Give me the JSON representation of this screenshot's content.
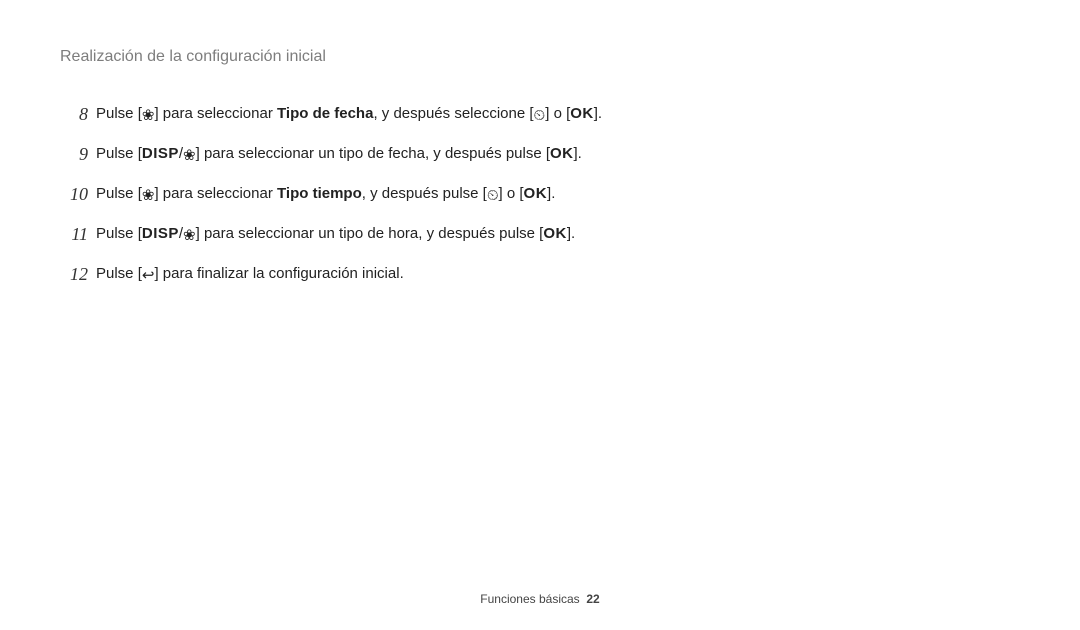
{
  "header": "Realización de la configuración inicial",
  "steps": [
    {
      "num": "8",
      "parts": [
        {
          "t": "text",
          "v": "Pulse ["
        },
        {
          "t": "icon",
          "name": "macro-icon",
          "glyph": "❀"
        },
        {
          "t": "text",
          "v": "] para seleccionar "
        },
        {
          "t": "bold",
          "v": "Tipo de fecha"
        },
        {
          "t": "text",
          "v": ", y después seleccione ["
        },
        {
          "t": "icon",
          "name": "timer-icon",
          "glyph": "⏲"
        },
        {
          "t": "text",
          "v": "] o ["
        },
        {
          "t": "ok",
          "v": "OK"
        },
        {
          "t": "text",
          "v": "]."
        }
      ]
    },
    {
      "num": "9",
      "parts": [
        {
          "t": "text",
          "v": "Pulse ["
        },
        {
          "t": "disp",
          "v": "DISP"
        },
        {
          "t": "text",
          "v": "/"
        },
        {
          "t": "icon",
          "name": "macro-icon",
          "glyph": "❀"
        },
        {
          "t": "text",
          "v": "] para seleccionar un tipo de fecha, y después pulse ["
        },
        {
          "t": "ok",
          "v": "OK"
        },
        {
          "t": "text",
          "v": "]."
        }
      ]
    },
    {
      "num": "10",
      "parts": [
        {
          "t": "text",
          "v": "Pulse ["
        },
        {
          "t": "icon",
          "name": "macro-icon",
          "glyph": "❀"
        },
        {
          "t": "text",
          "v": "] para seleccionar "
        },
        {
          "t": "bold",
          "v": "Tipo tiempo"
        },
        {
          "t": "text",
          "v": ", y después pulse ["
        },
        {
          "t": "icon",
          "name": "timer-icon",
          "glyph": "⏲"
        },
        {
          "t": "text",
          "v": "] o ["
        },
        {
          "t": "ok",
          "v": "OK"
        },
        {
          "t": "text",
          "v": "]."
        }
      ]
    },
    {
      "num": "11",
      "parts": [
        {
          "t": "text",
          "v": "Pulse ["
        },
        {
          "t": "disp",
          "v": "DISP"
        },
        {
          "t": "text",
          "v": "/"
        },
        {
          "t": "icon",
          "name": "macro-icon",
          "glyph": "❀"
        },
        {
          "t": "text",
          "v": "] para seleccionar un tipo de hora, y después pulse ["
        },
        {
          "t": "ok",
          "v": "OK"
        },
        {
          "t": "text",
          "v": "]."
        }
      ]
    },
    {
      "num": "12",
      "parts": [
        {
          "t": "text",
          "v": "Pulse ["
        },
        {
          "t": "icon",
          "name": "back-icon",
          "glyph": "↩"
        },
        {
          "t": "text",
          "v": "] para finalizar la configuración inicial."
        }
      ]
    }
  ],
  "footer": {
    "section": "Funciones básicas",
    "page": "22"
  },
  "icons": {
    "macro-icon": "❀",
    "timer-icon": "⏲",
    "back-icon": "↩"
  }
}
